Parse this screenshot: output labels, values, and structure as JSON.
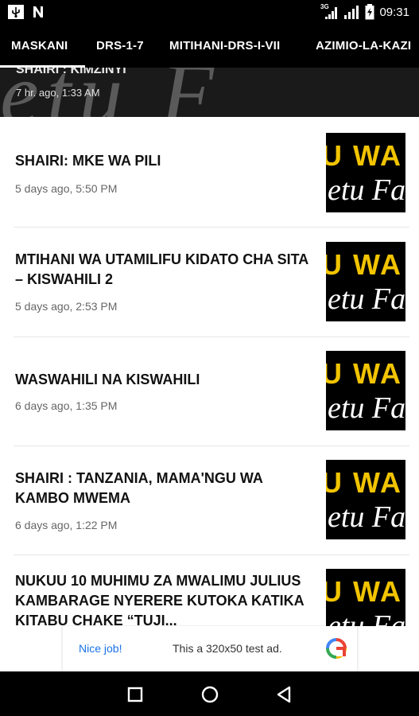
{
  "status_bar": {
    "time": "09:31",
    "network_label": "3G"
  },
  "tabs": [
    {
      "label": "MASKANI"
    },
    {
      "label": "DRS-1-7"
    },
    {
      "label": "MITIHANI-DRS-I-VII"
    },
    {
      "label": "AZIMIO-LA-KAZI"
    }
  ],
  "hero": {
    "title": "SHAIRI : KIMZINYI",
    "time": "7 hr. ago, 1:33 AM"
  },
  "articles": [
    {
      "title": "SHAIRI: MKE WA PILI",
      "time": "5 days ago, 5:50 PM"
    },
    {
      "title": "MTIHANI WA UTAMILIFU KIDATO CHA SITA – KISWAHILI 2",
      "time": "5 days ago, 2:53 PM"
    },
    {
      "title": "WASWAHILI NA KISWAHILI",
      "time": "6 days ago, 1:35 PM"
    },
    {
      "title": "SHAIRI : TANZANIA, MAMA'NGU WA KAMBO MWEMA",
      "time": "6 days ago, 1:22 PM"
    },
    {
      "title": "NUKUU 10 MUHIMU ZA MWALIMU JULIUS KAMBARAGE NYERERE KUTOKA KATIKA KITABU CHAKE “TUJI...",
      "time": ""
    }
  ],
  "thumbnail": {
    "line1": "U WA",
    "line2": "etu Fa"
  },
  "ad": {
    "cta": "Nice job!",
    "text": "This a 320x50 test ad."
  },
  "colors": {
    "tab_bar": "#000000",
    "thumb_yellow": "#f2c400",
    "ad_link": "#1a73e8"
  }
}
